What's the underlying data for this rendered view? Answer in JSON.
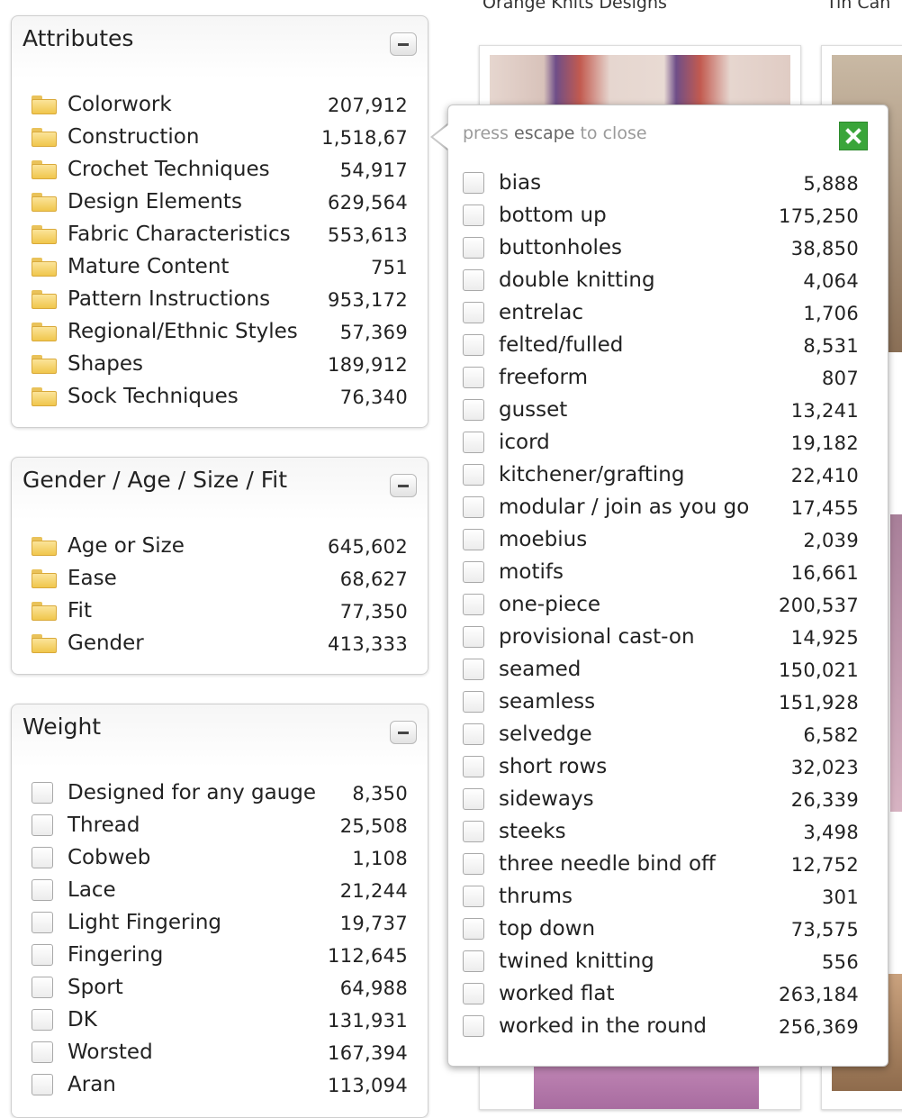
{
  "background": {
    "designers": [
      "Orange Knits Designs",
      "Tin Can"
    ]
  },
  "attributes": {
    "title": "Attributes",
    "items": [
      {
        "label": "Colorwork",
        "count": "207,912"
      },
      {
        "label": "Construction",
        "count": "1,518,67"
      },
      {
        "label": "Crochet Techniques",
        "count": "54,917"
      },
      {
        "label": "Design Elements",
        "count": "629,564"
      },
      {
        "label": "Fabric Characteristics",
        "count": "553,613"
      },
      {
        "label": "Mature Content",
        "count": "751"
      },
      {
        "label": "Pattern Instructions",
        "count": "953,172"
      },
      {
        "label": "Regional/Ethnic Styles",
        "count": "57,369"
      },
      {
        "label": "Shapes",
        "count": "189,912"
      },
      {
        "label": "Sock Techniques",
        "count": "76,340"
      }
    ]
  },
  "gender": {
    "title": "Gender / Age / Size / Fit",
    "items": [
      {
        "label": "Age or Size",
        "count": "645,602"
      },
      {
        "label": "Ease",
        "count": "68,627"
      },
      {
        "label": "Fit",
        "count": "77,350"
      },
      {
        "label": "Gender",
        "count": "413,333"
      }
    ]
  },
  "weight": {
    "title": "Weight",
    "items": [
      {
        "label": "Designed for any gauge",
        "count": "8,350"
      },
      {
        "label": "Thread",
        "count": "25,508"
      },
      {
        "label": "Cobweb",
        "count": "1,108"
      },
      {
        "label": "Lace",
        "count": "21,244"
      },
      {
        "label": "Light Fingering",
        "count": "19,737"
      },
      {
        "label": "Fingering",
        "count": "112,645"
      },
      {
        "label": "Sport",
        "count": "64,988"
      },
      {
        "label": "DK",
        "count": "131,931"
      },
      {
        "label": "Worsted",
        "count": "167,394"
      },
      {
        "label": "Aran",
        "count": "113,094"
      }
    ]
  },
  "popup": {
    "hint_press": "press",
    "hint_escape": "escape",
    "hint_rest": "to close",
    "items": [
      {
        "label": "bias",
        "count": "5,888"
      },
      {
        "label": "bottom up",
        "count": "175,250"
      },
      {
        "label": "buttonholes",
        "count": "38,850"
      },
      {
        "label": "double knitting",
        "count": "4,064"
      },
      {
        "label": "entrelac",
        "count": "1,706"
      },
      {
        "label": "felted/fulled",
        "count": "8,531"
      },
      {
        "label": "freeform",
        "count": "807"
      },
      {
        "label": "gusset",
        "count": "13,241"
      },
      {
        "label": "icord",
        "count": "19,182"
      },
      {
        "label": "kitchener/grafting",
        "count": "22,410"
      },
      {
        "label": "modular / join as you go",
        "count": "17,455"
      },
      {
        "label": "moebius",
        "count": "2,039"
      },
      {
        "label": "motifs",
        "count": "16,661"
      },
      {
        "label": "one-piece",
        "count": "200,537"
      },
      {
        "label": "provisional cast-on",
        "count": "14,925"
      },
      {
        "label": "seamed",
        "count": "150,021"
      },
      {
        "label": "seamless",
        "count": "151,928"
      },
      {
        "label": "selvedge",
        "count": "6,582"
      },
      {
        "label": "short rows",
        "count": "32,023"
      },
      {
        "label": "sideways",
        "count": "26,339"
      },
      {
        "label": "steeks",
        "count": "3,498"
      },
      {
        "label": "three needle bind off",
        "count": "12,752"
      },
      {
        "label": "thrums",
        "count": "301"
      },
      {
        "label": "top down",
        "count": "73,575"
      },
      {
        "label": "twined knitting",
        "count": "556"
      },
      {
        "label": "worked flat",
        "count": "263,184"
      },
      {
        "label": "worked in the round",
        "count": "256,369"
      }
    ]
  }
}
